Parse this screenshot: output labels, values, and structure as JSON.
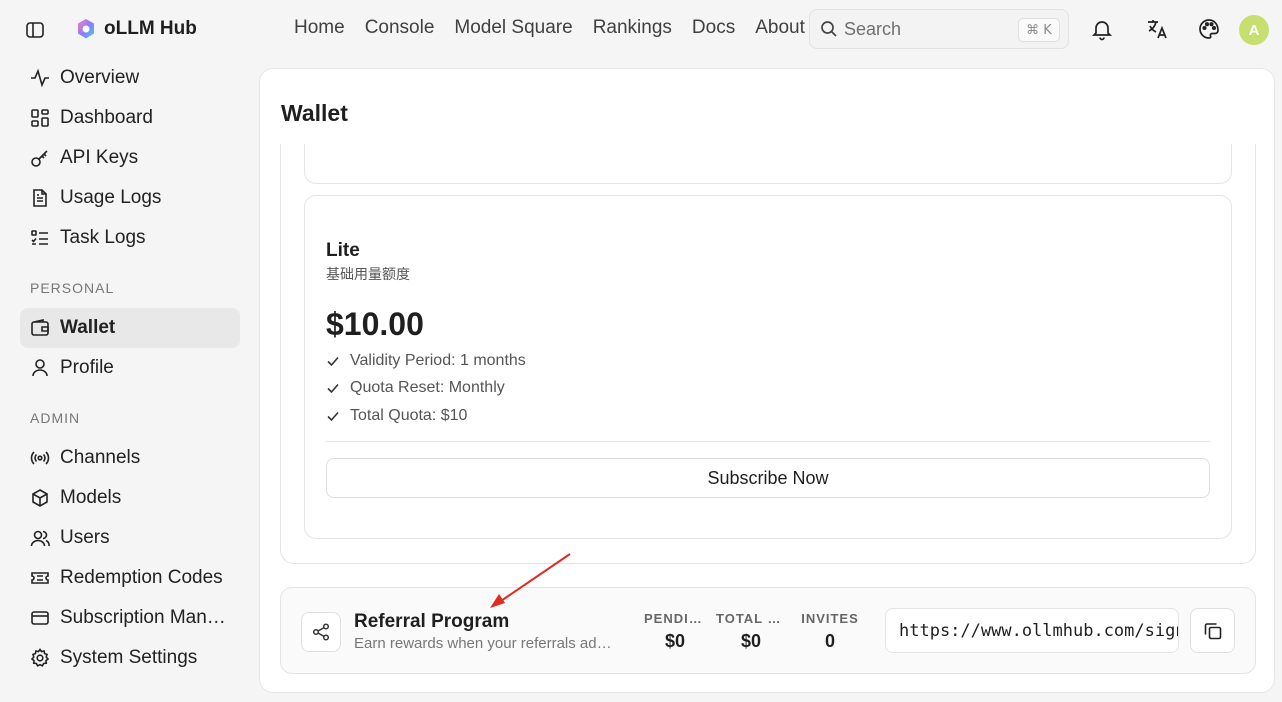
{
  "brand": {
    "name": "oLLM Hub"
  },
  "nav": [
    "Home",
    "Console",
    "Model Square",
    "Rankings",
    "Docs",
    "About"
  ],
  "search": {
    "placeholder": "Search",
    "shortcut": "⌘ K"
  },
  "user": {
    "avatar_initial": "A",
    "avatar_color": "#c7df6e"
  },
  "sidebar": {
    "items": [
      {
        "label": "Overview",
        "icon": "activity-icon"
      },
      {
        "label": "Dashboard",
        "icon": "dashboard-icon"
      },
      {
        "label": "API Keys",
        "icon": "key-icon"
      },
      {
        "label": "Usage Logs",
        "icon": "document-icon"
      },
      {
        "label": "Task Logs",
        "icon": "list-icon"
      }
    ],
    "personal_heading": "PERSONAL",
    "personal": [
      {
        "label": "Wallet",
        "icon": "wallet-icon",
        "active": true
      },
      {
        "label": "Profile",
        "icon": "user-icon"
      }
    ],
    "admin_heading": "ADMIN",
    "admin": [
      {
        "label": "Channels",
        "icon": "broadcast-icon"
      },
      {
        "label": "Models",
        "icon": "cube-icon"
      },
      {
        "label": "Users",
        "icon": "users-icon"
      },
      {
        "label": "Redemption Codes",
        "icon": "ticket-icon"
      },
      {
        "label": "Subscription Mana…",
        "icon": "card-icon"
      },
      {
        "label": "System Settings",
        "icon": "gear-icon"
      }
    ]
  },
  "page": {
    "title": "Wallet"
  },
  "plan": {
    "name": "Lite",
    "subtitle": "基础用量额度",
    "price": "$10.00",
    "features": [
      "Validity Period: 1 months",
      "Quota Reset: Monthly",
      "Total Quota: $10"
    ],
    "subscribe_label": "Subscribe Now"
  },
  "referral": {
    "title": "Referral Program",
    "description": "Earn rewards when your referrals ad…",
    "stats": [
      {
        "key": "PENDING",
        "value": "$0"
      },
      {
        "key": "TOTAL E…",
        "value": "$0"
      },
      {
        "key": "INVITES",
        "value": "0"
      }
    ],
    "link": "https://www.ollmhub.com/sign"
  },
  "annotation": {
    "arrow_color": "#e02b20"
  }
}
